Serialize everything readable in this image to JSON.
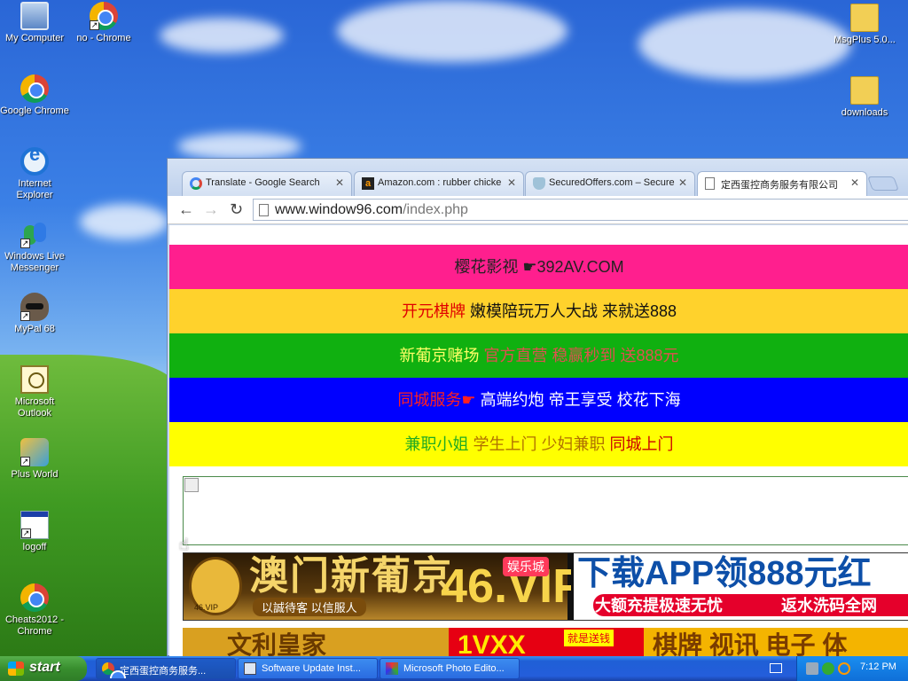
{
  "desktop": {
    "icons_left": [
      {
        "label": "My Computer",
        "icon": "my-computer-icon"
      },
      {
        "label": "no - Chrome",
        "icon": "chrome-icon"
      },
      {
        "label": "Google Chrome",
        "icon": "chrome-icon"
      },
      {
        "label": "Internet Explorer",
        "icon": "internet-explorer-icon"
      },
      {
        "label": "Windows Live Messenger",
        "icon": "messenger-icon"
      },
      {
        "label": "MyPal 68",
        "icon": "mypal-icon"
      },
      {
        "label": "Microsoft Outlook",
        "icon": "outlook-icon"
      },
      {
        "label": "Plus World",
        "icon": "plus-world-icon"
      },
      {
        "label": "logoff",
        "icon": "logoff-icon"
      },
      {
        "label": "Cheats2012 - Chrome",
        "icon": "chrome-icon"
      }
    ],
    "icons_right": [
      {
        "label": "MsgPlus 5.0...",
        "icon": "folder-icon"
      },
      {
        "label": "downloads",
        "icon": "folder-icon"
      }
    ]
  },
  "browser": {
    "tabs": [
      {
        "label": "Translate - Google Search",
        "icon": "google-icon"
      },
      {
        "label": "Amazon.com : rubber chicke",
        "icon": "amazon-icon"
      },
      {
        "label": "SecuredOffers.com – Secure",
        "icon": "shield-icon"
      },
      {
        "label": "定西蛋控商务服务有限公司",
        "icon": "page-icon"
      }
    ],
    "address": {
      "host": "www.window96.com",
      "path": "/index.php"
    },
    "banners": [
      {
        "parts": [
          "樱花影视 ☛392AV.COM"
        ]
      },
      {
        "parts": [
          "开元棋牌 ",
          "嫩模陪玩万人大战 来就送888"
        ]
      },
      {
        "parts": [
          "新葡京赌场 ",
          "官方直营 稳赢秒到 送888元"
        ]
      },
      {
        "parts": [
          "同城服务☛ ",
          "高端约炮 帝王享受 校花下海"
        ]
      },
      {
        "parts": [
          "兼职小姐 ",
          "学生上门 少妇兼职 ",
          "同城上门"
        ]
      }
    ],
    "banner_colors": [
      "#ff1f8e",
      "#ffd22c",
      "#10b010",
      "#0000ff",
      "#ffff00"
    ],
    "ad1": {
      "brand": "澳门新葡京",
      "vip": "46.VIP",
      "badge": "娱乐城",
      "slogan": "以誠待客 以信服人",
      "logo_tag": "46.VIP",
      "headline": "下载APP领888元红",
      "left_offer": "大额充提极速无忧",
      "right_offer": "返水洗码全网"
    },
    "ad2": {
      "a": "文利皇家",
      "b": "1VXX",
      "c": "就是送钱",
      "d": "棋牌 视讯 电子 体"
    }
  },
  "taskbar": {
    "start_label": "start",
    "buttons": [
      {
        "label": "定西蛋控商务服务...",
        "icon": "chrome-icon"
      },
      {
        "label": "Software Update Inst...",
        "icon": "software-update-icon"
      },
      {
        "label": "Microsoft Photo Edito...",
        "icon": "photo-editor-icon"
      }
    ],
    "clock": "7:12 PM"
  }
}
